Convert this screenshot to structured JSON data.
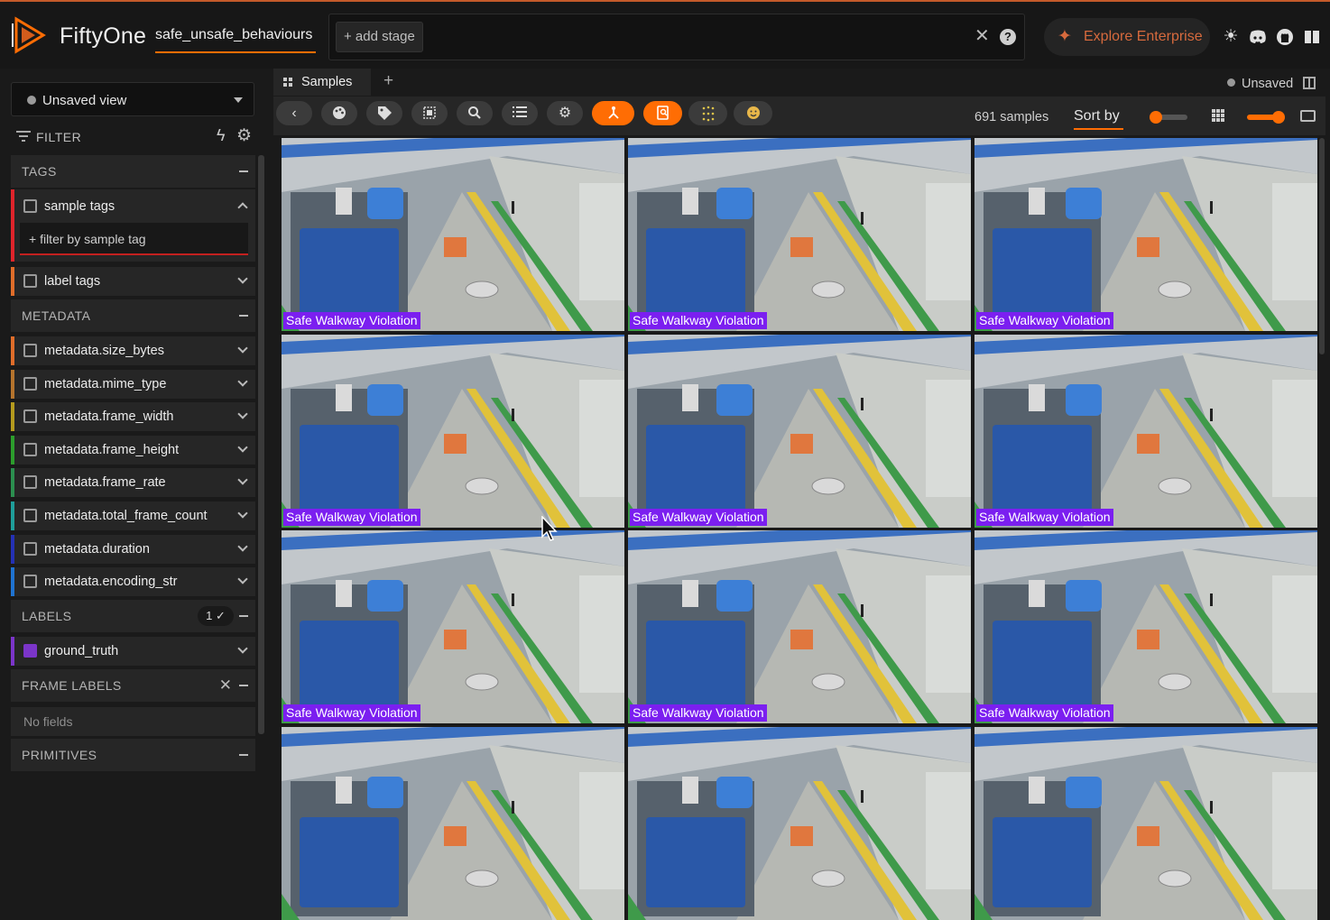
{
  "app": {
    "brand": "FiftyOne",
    "dataset_name": "safe_unsafe_behaviours",
    "add_stage_label": "+ add stage",
    "explore_enterprise_label": "Explore Enterprise",
    "accent_color": "#ff6d04",
    "top_icons": [
      "sun-icon",
      "discord-icon",
      "github-icon",
      "docs-book-icon"
    ]
  },
  "sidebar": {
    "view_selector": "Unsaved view",
    "filter_label": "FILTER",
    "sections": {
      "tags": "TAGS",
      "metadata": "METADATA",
      "labels": "LABELS",
      "labels_badge": "1 ✓",
      "frame_labels": "FRAME LABELS",
      "primitives": "PRIMITIVES"
    },
    "sample_tags": "sample tags",
    "tag_filter_placeholder": "+ filter by sample tag",
    "label_tags": "label tags",
    "metadata_fields": [
      {
        "name": "metadata.size_bytes",
        "color": "#e06d2a"
      },
      {
        "name": "metadata.mime_type",
        "color": "#b5742d"
      },
      {
        "name": "metadata.frame_width",
        "color": "#b59b1e"
      },
      {
        "name": "metadata.frame_height",
        "color": "#2c9e2c"
      },
      {
        "name": "metadata.frame_rate",
        "color": "#2b8f4f"
      },
      {
        "name": "metadata.total_frame_count",
        "color": "#1f9e9a"
      },
      {
        "name": "metadata.duration",
        "color": "#2431b5"
      },
      {
        "name": "metadata.encoding_str",
        "color": "#1f73d1"
      }
    ],
    "ground_truth": "ground_truth",
    "no_fields": "No fields"
  },
  "main": {
    "tab_label": "Samples",
    "unsaved_label": "Unsaved",
    "sample_count": "691 samples",
    "sort_by": "Sort by",
    "tile_label": "Safe Walkway Violation",
    "tiles": [
      {
        "label": "Safe Walkway Violation"
      },
      {
        "label": "Safe Walkway Violation"
      },
      {
        "label": "Safe Walkway Violation"
      },
      {
        "label": "Safe Walkway Violation"
      },
      {
        "label": "Safe Walkway Violation"
      },
      {
        "label": "Safe Walkway Violation"
      },
      {
        "label": "Safe Walkway Violation"
      },
      {
        "label": "Safe Walkway Violation"
      },
      {
        "label": "Safe Walkway Violation"
      },
      {
        "label": ""
      },
      {
        "label": ""
      },
      {
        "label": ""
      }
    ]
  }
}
